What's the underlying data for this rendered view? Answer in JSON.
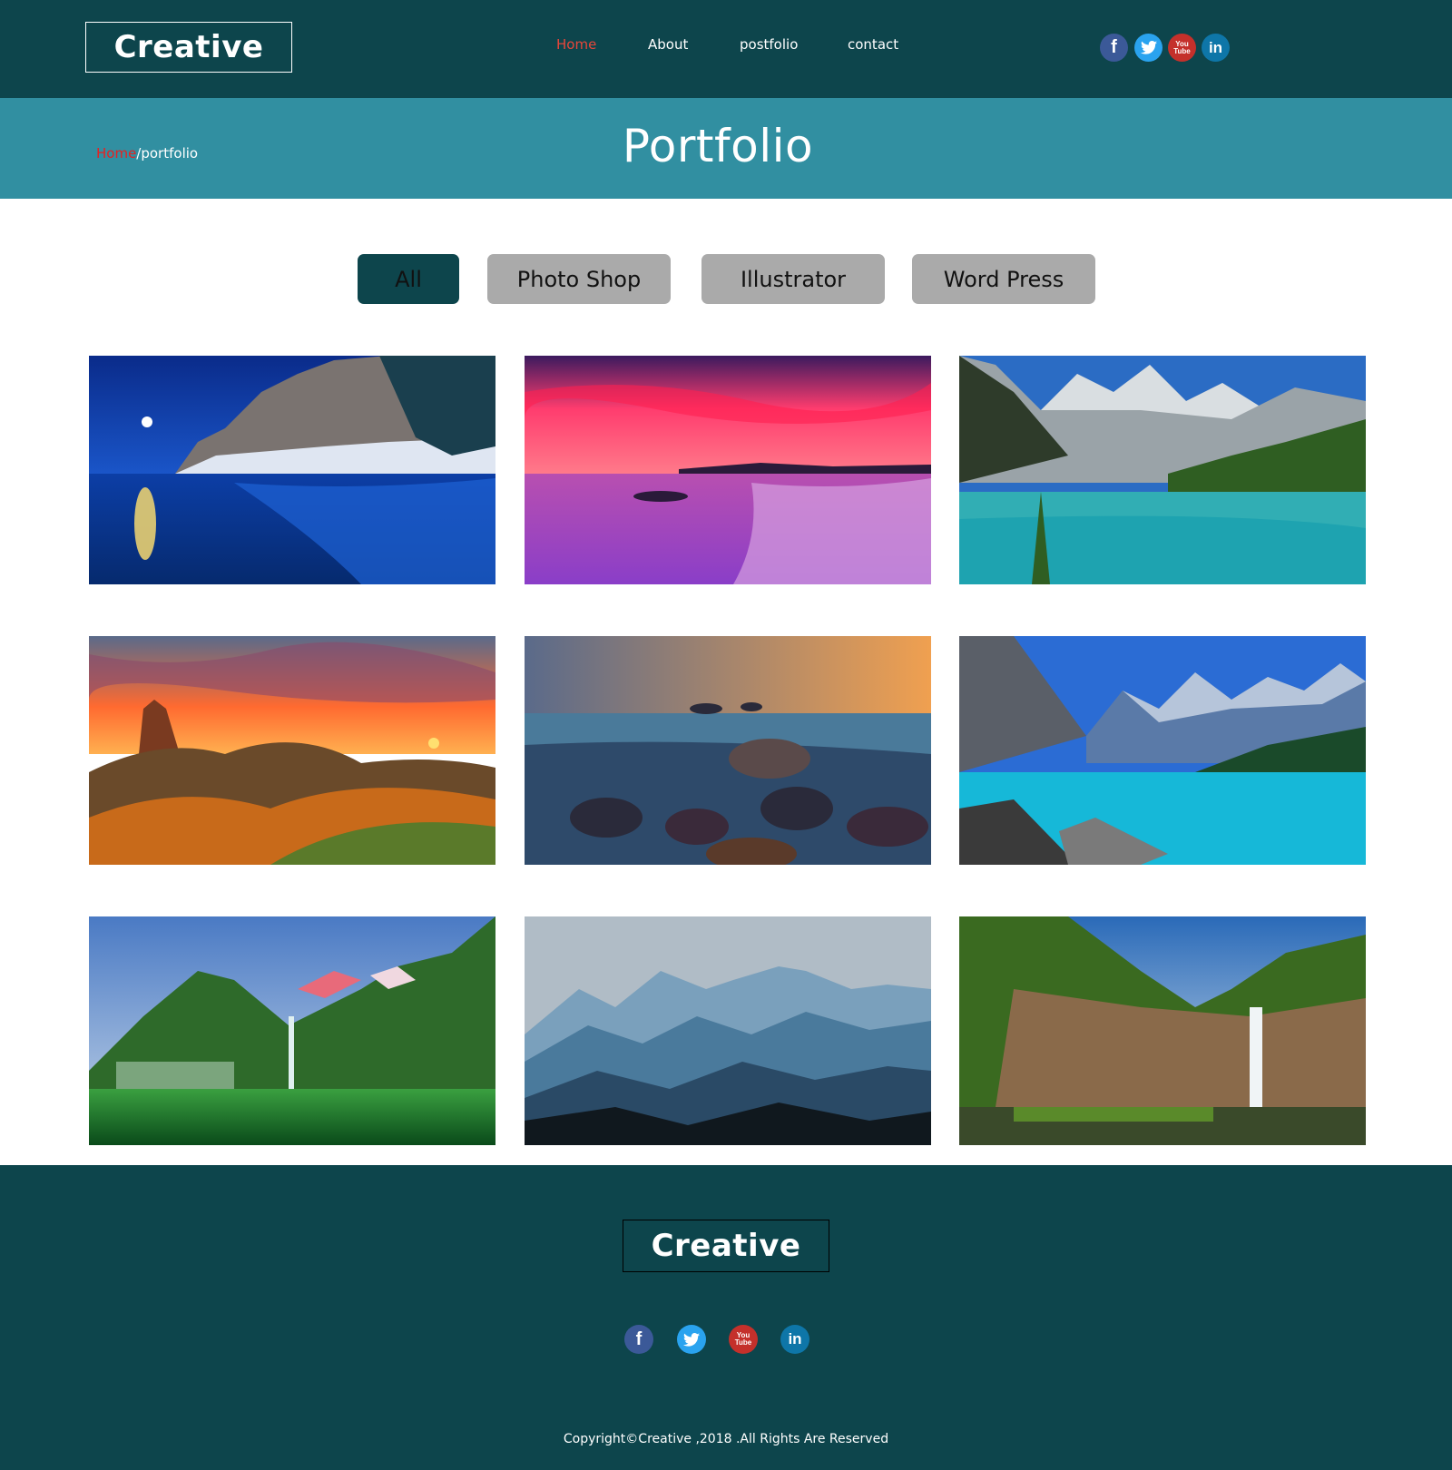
{
  "header": {
    "logo": "Creative",
    "nav": [
      {
        "label": "Home",
        "active": true
      },
      {
        "label": "About",
        "active": false
      },
      {
        "label": "postfolio",
        "active": false
      },
      {
        "label": "contact",
        "active": false
      }
    ],
    "social": [
      {
        "icon": "facebook-icon",
        "glyph": "f",
        "color": "#3b5998"
      },
      {
        "icon": "twitter-icon",
        "glyph": "🐦",
        "color": "#1da1f2"
      },
      {
        "icon": "youtube-icon",
        "glyph": "You Tube",
        "color": "#c4302b"
      },
      {
        "icon": "linkedin-icon",
        "glyph": "in",
        "color": "#0077b5"
      }
    ]
  },
  "banner": {
    "breadcrumb_home": "Home",
    "breadcrumb_sep": "/",
    "breadcrumb_current": "portfolio",
    "title": "Portfolio"
  },
  "filters": [
    {
      "label": "All",
      "active": true
    },
    {
      "label": "Photo Shop",
      "active": false
    },
    {
      "label": "Illustrator",
      "active": false
    },
    {
      "label": "Word Press",
      "active": false
    }
  ],
  "gallery": [
    {
      "name": "moonlit-snowy-lake"
    },
    {
      "name": "pink-sunset-beach"
    },
    {
      "name": "mountain-lake-teal"
    },
    {
      "name": "autumn-sunset-mountains"
    },
    {
      "name": "rocky-sea-shore"
    },
    {
      "name": "turquoise-glacier-lake"
    },
    {
      "name": "green-fjord-waterfall"
    },
    {
      "name": "misty-blue-mountains"
    },
    {
      "name": "jungle-waterfall"
    }
  ],
  "footer": {
    "logo": "Creative",
    "copyright": "Copyright©Creative ,2018 .All Rights Are Reserved"
  },
  "colors": {
    "dark_teal": "#0d454c",
    "banner_teal": "#318fa1",
    "accent_red": "#e8463a",
    "filter_grey": "#aaaaaa"
  }
}
